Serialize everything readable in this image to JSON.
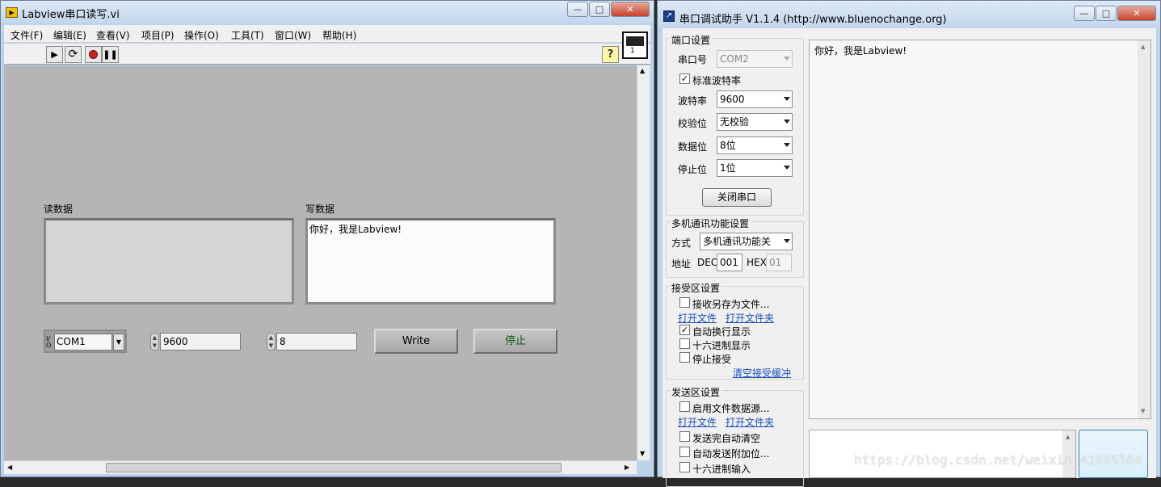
{
  "labview": {
    "title": "Labview串口读写.vi",
    "menu": [
      "文件(F)",
      "编辑(E)",
      "查看(V)",
      "项目(P)",
      "操作(O)",
      "工具(T)",
      "窗口(W)",
      "帮助(H)"
    ],
    "help_glyph": "?",
    "icon_num": "1",
    "read_label": "读数据",
    "read_value": "",
    "write_label": "写数据",
    "write_value": "你好，我是Labview!",
    "port_prefix": "I/O",
    "port_value": "COM1",
    "baud_value": "9600",
    "databits_value": "8",
    "write_button": "Write",
    "stop_button": "停止"
  },
  "assistant": {
    "title": "串口调试助手 V1.1.4 (http://www.bluenochange.org)",
    "port_settings": {
      "title": "端口设置",
      "port_label": "串口号",
      "port_value": "COM2",
      "std_baud_label": "标准波特率",
      "std_baud_checked": true,
      "baud_label": "波特率",
      "baud_value": "9600",
      "parity_label": "校验位",
      "parity_value": "无校验",
      "databits_label": "数据位",
      "databits_value": "8位",
      "stopbits_label": "停止位",
      "stopbits_value": "1位",
      "close_button": "关闭串口"
    },
    "multi": {
      "title": "多机通讯功能设置",
      "mode_label": "方式",
      "mode_value": "多机通讯功能关",
      "addr_label": "地址",
      "dec_label": "DEC",
      "dec_value": "001",
      "hex_label": "HEX",
      "hex_value": "01"
    },
    "receive": {
      "title": "接受区设置",
      "save_file": "接收另存为文件...",
      "open_file": "打开文件",
      "open_folder": "打开文件夹",
      "auto_newline": "自动换行显示",
      "auto_newline_checked": true,
      "hex_display": "十六进制显示",
      "stop_receive": "停止接受",
      "clear_buffer": "清空接受缓冲"
    },
    "send": {
      "title": "发送区设置",
      "file_source": "启用文件数据源...",
      "open_file": "打开文件",
      "open_folder": "打开文件夹",
      "auto_clear": "发送完自动清空",
      "auto_append": "自动发送附加位...",
      "hex_input": "十六进制输入"
    },
    "receive_text": "你好，我是Labview!",
    "send_text": ""
  },
  "watermark": "https://blog.csdn.net/weixin_41695564",
  "colors": {
    "labview_panel": "#b5b5b5",
    "link": "#1a4fbf",
    "stop_text": "#0f5a12"
  },
  "glyphs": {
    "checked": "✓",
    "minimize": "—",
    "maximize": "□",
    "close": "✕",
    "arrow_up": "▲",
    "arrow_down": "▼",
    "arrow_left": "◀",
    "arrow_right": "▶"
  }
}
